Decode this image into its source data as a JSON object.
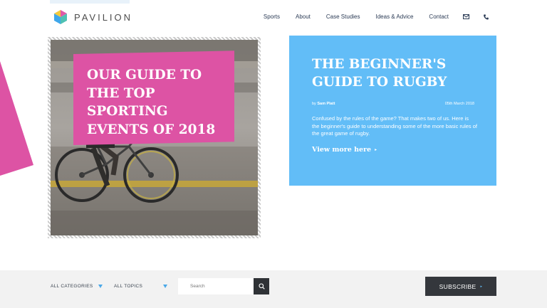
{
  "brand": {
    "name": "PAVILION"
  },
  "nav": {
    "items": [
      {
        "label": "Sports"
      },
      {
        "label": "About"
      },
      {
        "label": "Case Studies"
      },
      {
        "label": "Ideas & Advice"
      },
      {
        "label": "Contact"
      }
    ],
    "icons": [
      "envelope-icon",
      "phone-icon"
    ]
  },
  "featured": {
    "title": "OUR GUIDE TO THE TOP SPORTING EVENTS OF 2018",
    "accent_color": "#dd53a4"
  },
  "article": {
    "title": "THE BEGINNER'S GUIDE TO RUGBY",
    "by_prefix": "by",
    "author": "Sam Platt",
    "date": "05th March 2018",
    "excerpt": "Confused by the rules of the game? That makes two of us. Here is the beginner's guide to understanding some of the more basic rules of the great game of rugby.",
    "link_label": "View more here",
    "link_arrow": "▸",
    "background_color": "#62bdf7"
  },
  "filters": {
    "categories_label": "ALL CATEGORIES",
    "topics_label": "ALL TOPICS",
    "search_placeholder": "Search",
    "subscribe_label": "SUBSCRIBE",
    "subscribe_arrow": "▸",
    "accent_color": "#4aa8e8"
  }
}
